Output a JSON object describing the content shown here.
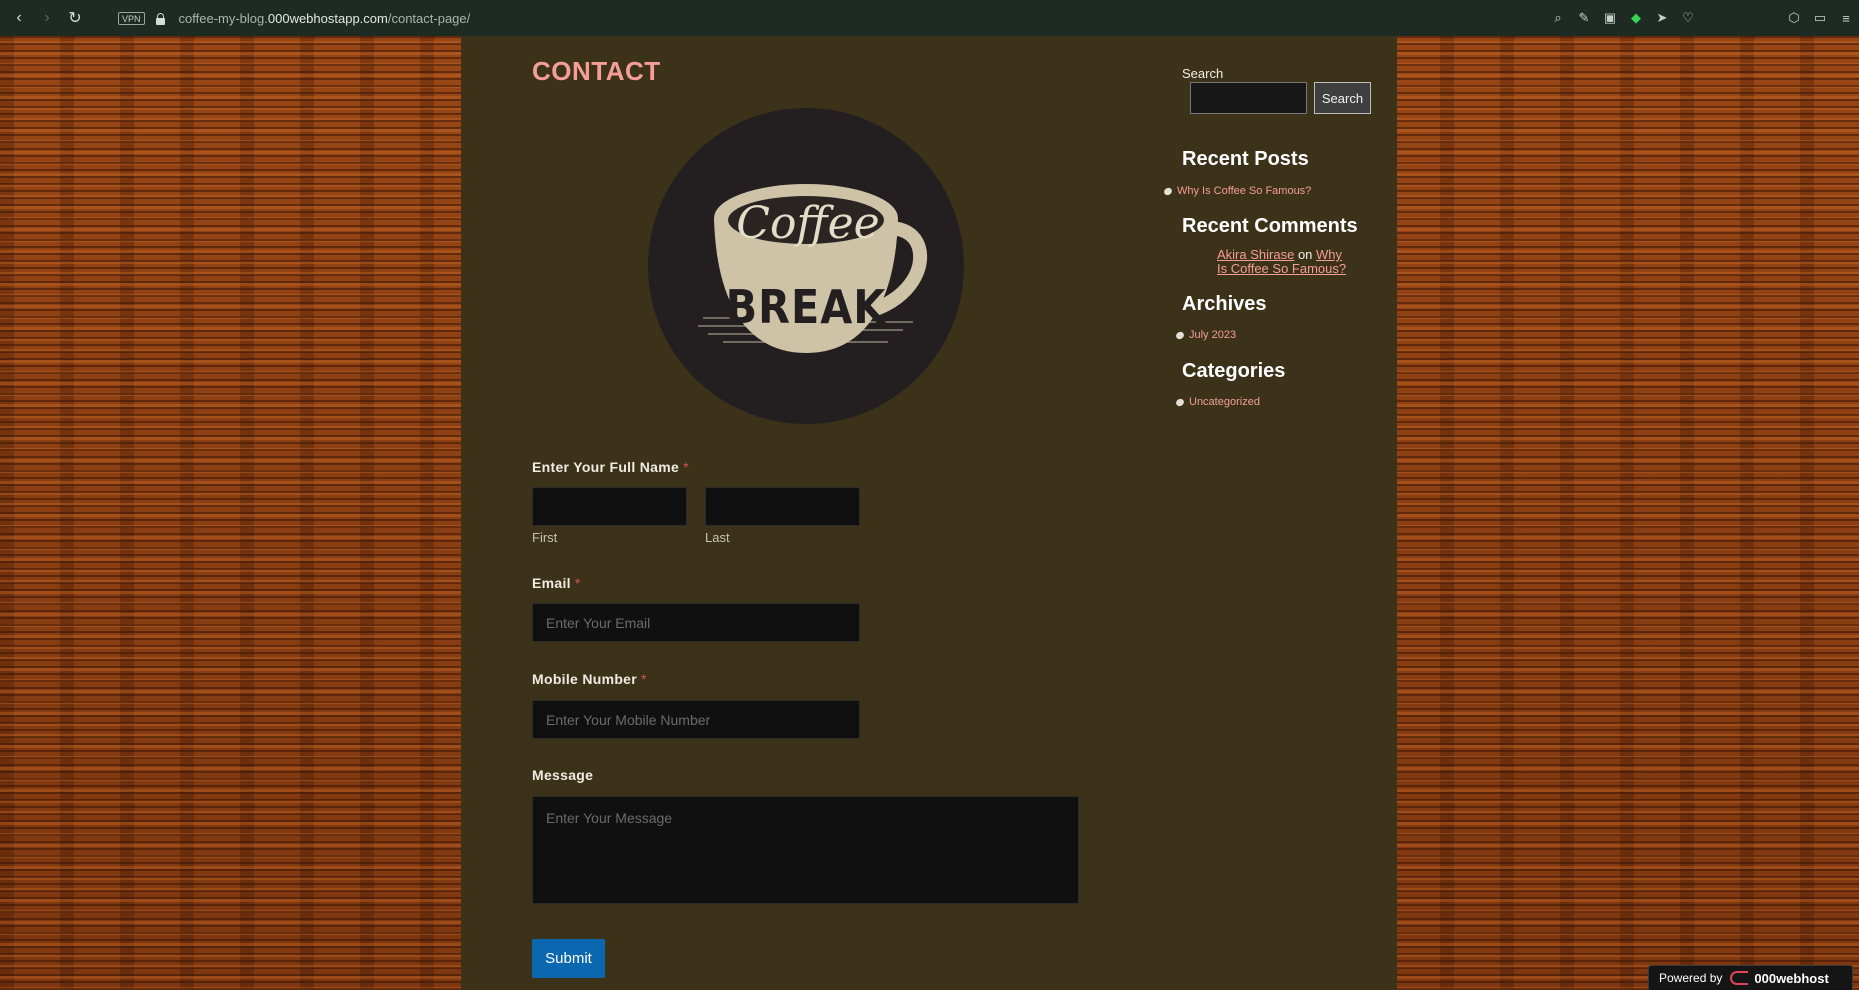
{
  "browser": {
    "url_prefix": "coffee-my-blog.",
    "url_domain": "000webhostapp.com",
    "url_path": "/contact-page/",
    "vpn_label": "VPN"
  },
  "page": {
    "title": "CONTACT",
    "logo_text_top": "Coffee",
    "logo_text_bottom": "BREAK"
  },
  "form": {
    "name_label": "Enter Your Full Name",
    "required_mark": "*",
    "first_sublabel": "First",
    "last_sublabel": "Last",
    "email_label": "Email",
    "email_placeholder": "Enter Your Email",
    "mobile_label": "Mobile Number",
    "mobile_placeholder": "Enter Your Mobile Number",
    "message_label": "Message",
    "message_placeholder": "Enter Your Message",
    "submit_label": "Submit"
  },
  "sidebar": {
    "search_label": "Search",
    "search_button": "Search",
    "recent_posts_heading": "Recent Posts",
    "recent_posts": [
      "Why Is Coffee So Famous?"
    ],
    "recent_comments_heading": "Recent Comments",
    "comment_author": "Akira Shirase",
    "comment_on": "on",
    "comment_post": "Why Is Coffee So Famous?",
    "archives_heading": "Archives",
    "archives": [
      "July 2023"
    ],
    "categories_heading": "Categories",
    "categories": [
      "Uncategorized"
    ]
  },
  "footer_badge": {
    "powered_by": "Powered by",
    "brand": "000webhost"
  },
  "colors": {
    "column_bg": "#3b3219",
    "accent_pink": "#f59e97",
    "submit_blue": "#0a67b0"
  }
}
